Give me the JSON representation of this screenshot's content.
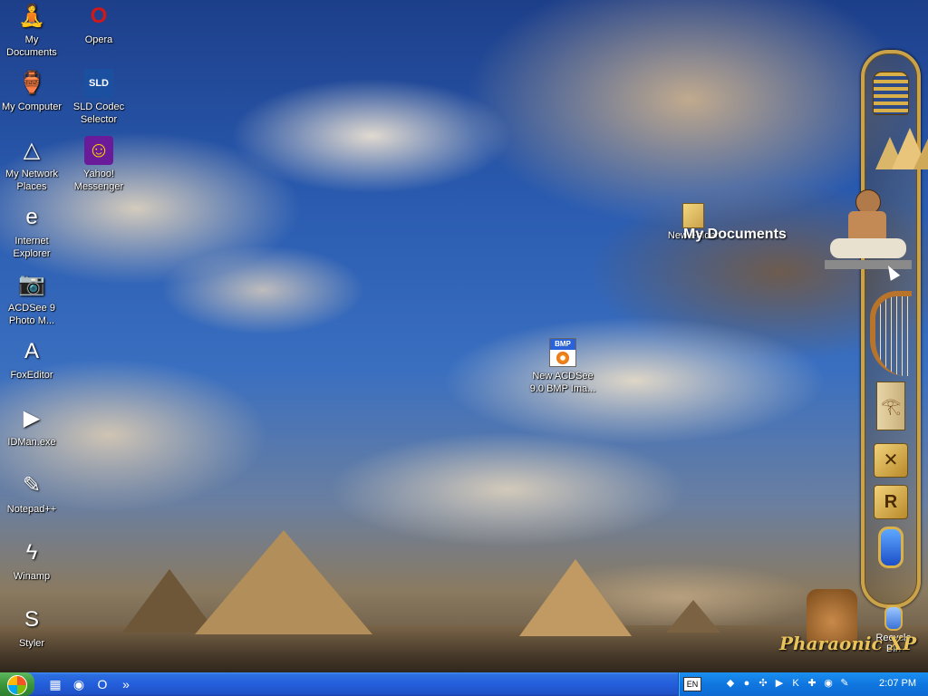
{
  "desktop": {
    "icons_left": [
      {
        "label": "My\nDocuments",
        "icon": "my-documents-icon",
        "glyph": "🧘"
      },
      {
        "label": "My Computer",
        "icon": "my-computer-icon",
        "glyph": "🏺"
      },
      {
        "label": "My Network\nPlaces",
        "icon": "network-places-icon",
        "glyph": "△"
      },
      {
        "label": "Internet\nExplorer",
        "icon": "internet-explorer-icon",
        "glyph": "e"
      },
      {
        "label": "ACDSee 9\nPhoto M...",
        "icon": "acdsee-icon",
        "glyph": "📷"
      },
      {
        "label": "FoxEditor",
        "icon": "foxeditor-icon",
        "glyph": "A"
      },
      {
        "label": "IDMan.exe",
        "icon": "idman-icon",
        "glyph": "▶"
      },
      {
        "label": "Notepad++",
        "icon": "notepad-plus-icon",
        "glyph": "✎"
      },
      {
        "label": "Winamp",
        "icon": "winamp-icon",
        "glyph": "ϟ"
      },
      {
        "label": "Styler",
        "icon": "styler-icon",
        "glyph": "S"
      }
    ],
    "icons_right_col": [
      {
        "label": "Opera",
        "icon": "opera-icon",
        "glyph": "O"
      },
      {
        "label": "SLD Codec\nSelector",
        "icon": "sld-codec-icon",
        "glyph": "SLD"
      },
      {
        "label": "Yahoo!\nMessenger",
        "icon": "yahoo-messenger-icon",
        "glyph": "☺"
      }
    ],
    "new_folder": {
      "label": "New Folder"
    },
    "tooltip_title": "My Documents",
    "bmp_file": {
      "label": "New ACDSee\n9.0 BMP Ima...",
      "badge": "BMP"
    },
    "recycle_bin": {
      "label": "Recycle Bin"
    },
    "brand_logo": "Pharaonic XP"
  },
  "sidebar": {
    "items": [
      {
        "name": "pharaoh-mask-icon"
      },
      {
        "name": "pyramids-icon"
      },
      {
        "name": "seated-scribe-icon"
      },
      {
        "name": "harp-icon"
      },
      {
        "name": "book-icon"
      },
      {
        "name": "tools-icon"
      },
      {
        "name": "registry-icon"
      },
      {
        "name": "cartouche-icon"
      }
    ]
  },
  "taskbar": {
    "quick_launch": [
      {
        "name": "show-desktop-icon",
        "glyph": "▦"
      },
      {
        "name": "firefox-icon",
        "glyph": "◉"
      },
      {
        "name": "opera-launch-icon",
        "glyph": "O"
      },
      {
        "name": "expand-chevron-icon",
        "glyph": "»"
      }
    ],
    "tray": {
      "language": "EN",
      "icons": [
        "shield-icon",
        "messenger-icon",
        "network-icon",
        "idm-tray-icon",
        "kaspersky-icon",
        "tool-icon",
        "camera-icon",
        "pen-icon"
      ],
      "clock": "2:07 PM"
    }
  },
  "colors": {
    "taskbar_blue": "#245edb",
    "start_green": "#3a963a",
    "tray_blue": "#1077e0",
    "sidebar_gold": "#caa24a"
  }
}
